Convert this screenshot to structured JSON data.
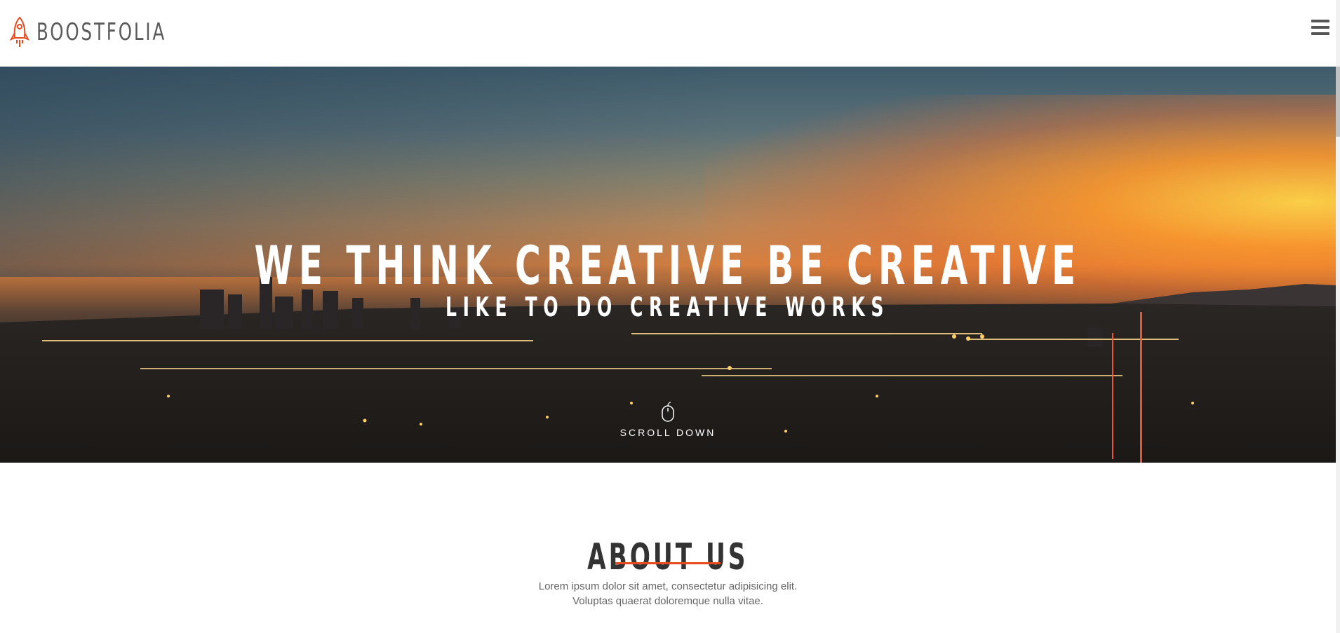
{
  "header": {
    "brand_name": "BOOSTFOLIA",
    "menu_icon": "hamburger-menu-icon",
    "logo_icon": "rocket-icon"
  },
  "hero": {
    "title": "WE THINK CREATIVE BE CREATIVE",
    "subtitle": "LIKE TO DO CREATIVE WORKS",
    "scroll_label": "SCROLL DOWN",
    "scroll_icon": "mouse-icon"
  },
  "about": {
    "title": "ABOUT US",
    "text_line1": "Lorem ipsum dolor sit amet, consectetur adipisicing elit.",
    "text_line2": "Voluptas quaerat doloremque nulla vitae."
  },
  "colors": {
    "accent": "#e8491d",
    "brand_text": "#5a5a5a",
    "heading": "#333333",
    "body_text": "#666666"
  }
}
